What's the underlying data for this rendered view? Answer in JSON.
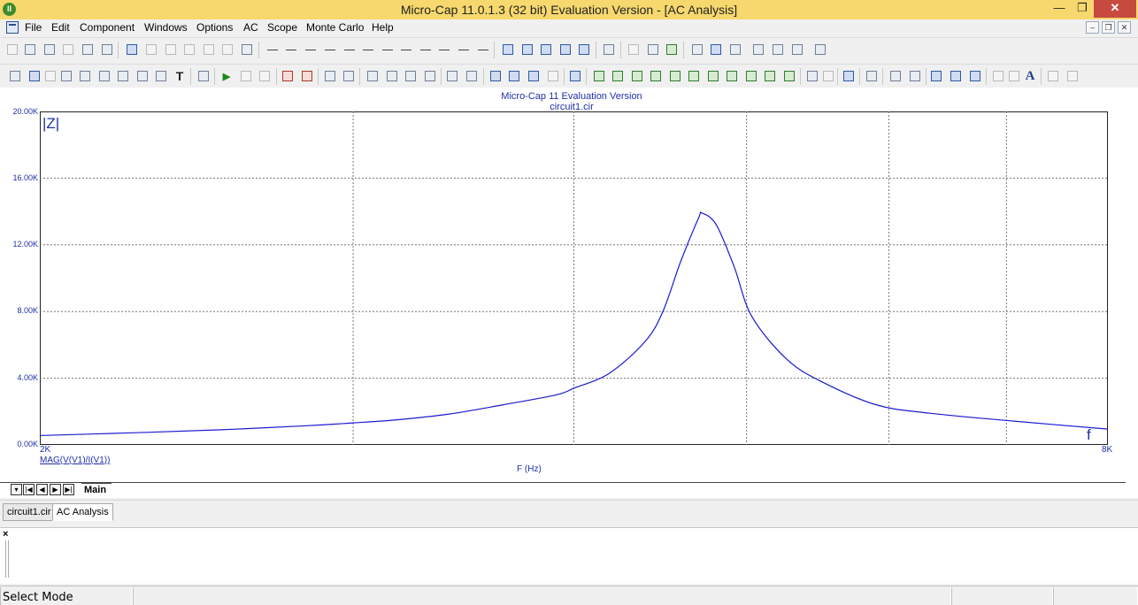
{
  "window": {
    "title": "Micro-Cap 11.0.1.3 (32 bit) Evaluation Version - [AC Analysis]",
    "app_icon_glyph": "II",
    "controls": {
      "minimize": "—",
      "maximize": "❐",
      "close": "✕"
    },
    "mdi_controls": {
      "minimize": "–",
      "restore": "❐",
      "close": "✕"
    }
  },
  "menu": {
    "items": [
      "File",
      "Edit",
      "Component",
      "Windows",
      "Options",
      "AC",
      "Scope",
      "Monte Carlo",
      "Help"
    ]
  },
  "toolbar2": {
    "text_tool_glyph": "T",
    "play_glyph": "▶",
    "font_tool_glyph": "A"
  },
  "plot": {
    "title_line1": "Micro-Cap 11 Evaluation Version",
    "title_line2": "circuit1.cir",
    "y_ticks": [
      "20.00K",
      "16.00K",
      "12.00K",
      "8.00K",
      "4.00K",
      "0.00K"
    ],
    "x_min_label": "2K",
    "x_max_label": "8K",
    "x_axis_label": "F (Hz)",
    "curve_expression": "MAG(V(V1)/I(V1))",
    "y_marker": "|Z|",
    "x_marker": "f"
  },
  "chart_data": {
    "type": "line",
    "xlabel": "F (Hz)",
    "ylabel": "",
    "xlim": [
      2000,
      8000
    ],
    "ylim": [
      0,
      20000
    ],
    "grid": true,
    "vertical_grid_x": [
      3760,
      5000,
      5970,
      6770,
      7430
    ],
    "series": [
      {
        "name": "MAG(V(V1)/I(V1))",
        "color": "#1a1ad0",
        "x": [
          2000,
          2500,
          3000,
          3500,
          3760,
          4000,
          4300,
          4600,
          4900,
          5000,
          5200,
          5400,
          5500,
          5600,
          5700,
          5720,
          5800,
          5900,
          6000,
          6200,
          6400,
          6700,
          7000,
          7500,
          8000
        ],
        "y": [
          560,
          720,
          900,
          1150,
          1320,
          1500,
          1850,
          2400,
          3000,
          3400,
          4300,
          6200,
          8000,
          11000,
          13600,
          13900,
          13200,
          10700,
          7700,
          5100,
          3750,
          2400,
          1900,
          1400,
          950
        ]
      }
    ]
  },
  "sheet": {
    "nav": [
      "▾",
      "|◀",
      "◀",
      "▶",
      "▶|"
    ],
    "active_tab": "Main"
  },
  "document_tabs": [
    {
      "label": "circuit1.cir",
      "active": false
    },
    {
      "label": "AC Analysis",
      "active": true
    }
  ],
  "output_panel": {
    "close_glyph": "×"
  },
  "status": {
    "mode": "Select Mode"
  }
}
